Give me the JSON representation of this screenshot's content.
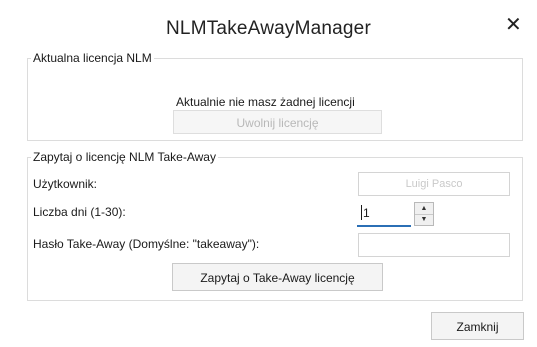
{
  "window": {
    "title": "NLMTakeAwayManager",
    "close_glyph": "✕"
  },
  "current_license": {
    "legend": "Aktualna licencja NLM",
    "status_text": "Aktualnie nie masz żadnej licencji",
    "release_button": "Uwolnij licencję"
  },
  "request": {
    "legend": "Zapytaj o licencję NLM Take-Away",
    "user_label": "Użytkownik:",
    "user_value": "Luigi Pasco",
    "days_label": "Liczba dni (1-30):",
    "days_value": "1",
    "password_label": "Hasło Take-Away (Domyślne: \"takeaway\"):",
    "password_value": "",
    "request_button": "Zapytaj o Take-Away licencję"
  },
  "footer": {
    "close_button": "Zamknij"
  },
  "colors": {
    "focus_accent": "#2b6fb5",
    "border": "#d4d4d4",
    "disabled_text": "#b8b8b8"
  }
}
